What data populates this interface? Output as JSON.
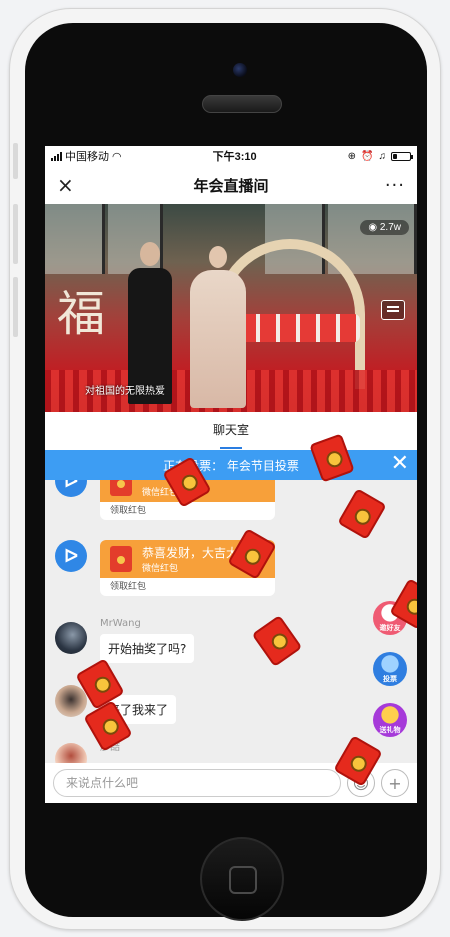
{
  "status_bar": {
    "carrier": "中国移动",
    "time": "下午3:10",
    "battery_level": 0.25
  },
  "nav": {
    "close_icon": "×",
    "title": "年会直播间",
    "more_icon": "···"
  },
  "video": {
    "views": "◉ 2.7w",
    "caption": "对祖国的无限热爱"
  },
  "tabs": [
    {
      "label": "聊天室"
    }
  ],
  "vote_banner": {
    "text": "正在投票：  年会节目投票",
    "close_icon": "✕"
  },
  "messages": [
    {
      "type": "redpacket",
      "title": "",
      "subtitle": "微信红包",
      "action": "领取红包"
    },
    {
      "type": "redpacket",
      "title": "恭喜发财，大吉大利",
      "subtitle": "微信红包",
      "action": "领取红包"
    },
    {
      "type": "text",
      "username": "MrWang",
      "text": "开始抽奖了吗?"
    },
    {
      "type": "text",
      "username": "",
      "text": "来了我来了"
    },
    {
      "type": "text",
      "username": "彦喆",
      "text": ""
    }
  ],
  "side_buttons": {
    "invite": "邀好友",
    "vote": "投票",
    "gift": "送礼物"
  },
  "input": {
    "placeholder": "来说点什么吧",
    "emoji_icon": "☺",
    "plus_icon": "+"
  },
  "colors": {
    "accent": "#3d9df3",
    "redpacket": "#f7a03a",
    "envelope": "#e52a1d"
  }
}
